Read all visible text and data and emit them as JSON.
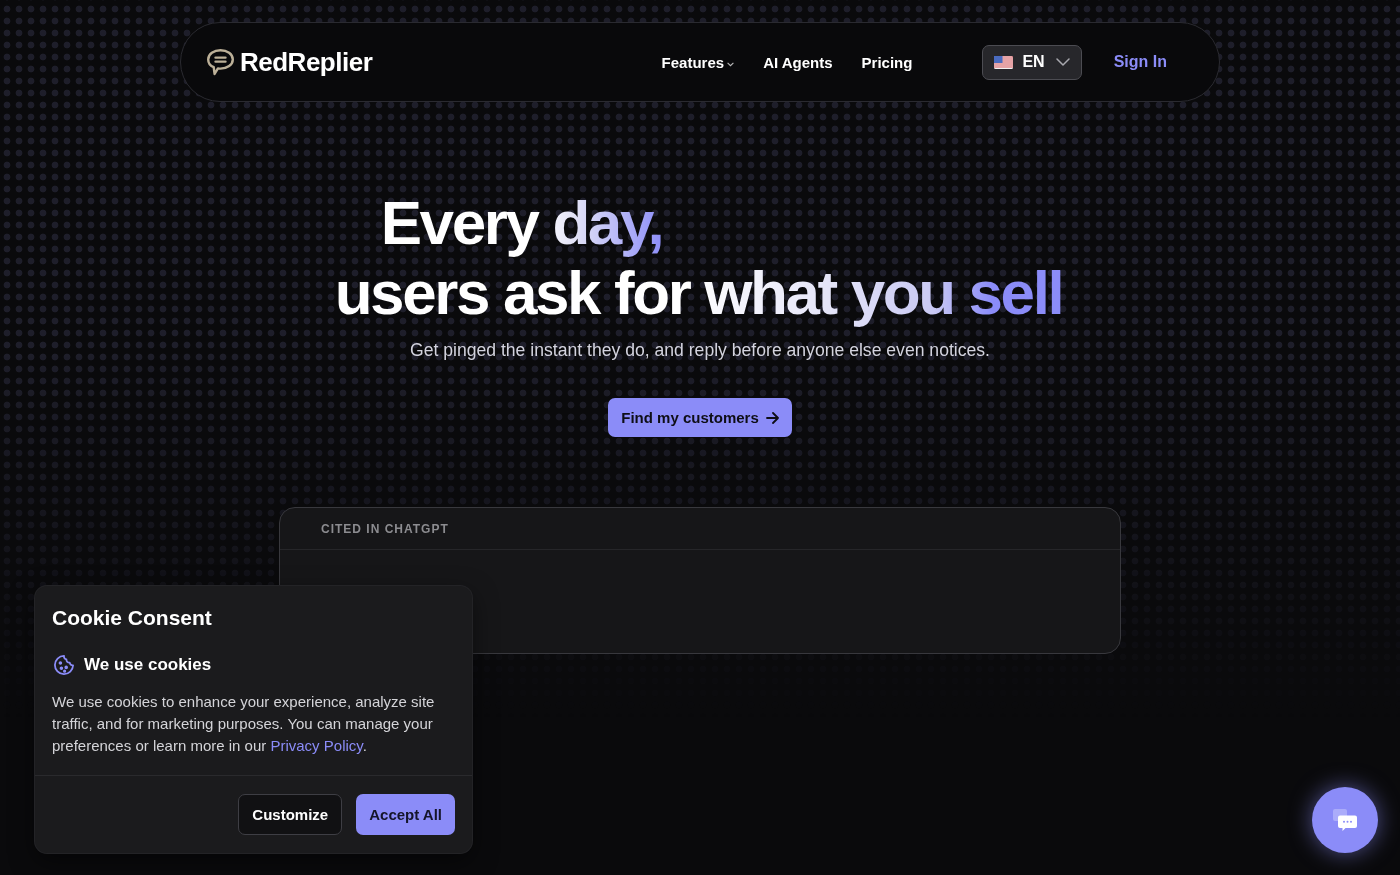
{
  "nav": {
    "logo": "RedReplier",
    "links": [
      {
        "label": "Features",
        "has_menu": true
      },
      {
        "label": "AI Agents",
        "has_menu": false
      },
      {
        "label": "Pricing",
        "has_menu": false
      }
    ],
    "language": "EN",
    "sign_in": "Sign In"
  },
  "hero": {
    "headline": [
      "Every day,",
      "users ask for what you sell"
    ],
    "subtitle": "Get pinged the instant they do, and reply before anyone else even notices.",
    "cta": "Find my customers"
  },
  "cited_card": {
    "label": "CITED IN CHATGPT"
  },
  "cookie_consent": {
    "title": "Cookie Consent",
    "heading": "We use cookies",
    "text_before": "We use cookies to enhance your experience, analyze site traffic, and for marketing purposes. You can manage your preferences or learn more in our ",
    "link": "Privacy Policy",
    "text_after": ".",
    "buttons": [
      {
        "label": "Customize",
        "kind": "secondary"
      },
      {
        "label": "Accept All",
        "kind": "primary"
      }
    ]
  }
}
